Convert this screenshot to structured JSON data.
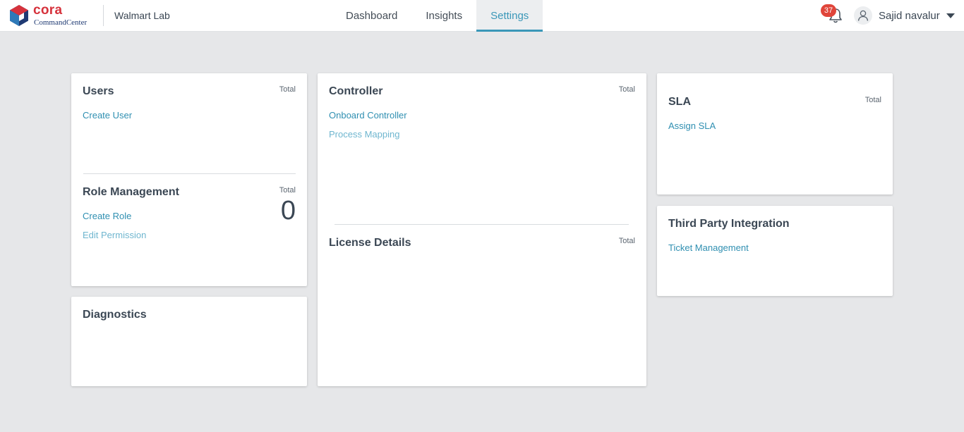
{
  "header": {
    "logo": {
      "brand": "cora",
      "product": "CommandCenter"
    },
    "org_name": "Walmart Lab",
    "tabs": [
      {
        "label": "Dashboard",
        "active": false
      },
      {
        "label": "Insights",
        "active": false
      },
      {
        "label": "Settings",
        "active": true
      }
    ],
    "notifications": {
      "icon": "bell-icon",
      "count": "37"
    },
    "user": {
      "icon": "user-icon",
      "name": "Sajid navalur",
      "menu_icon": "caret-down-icon"
    }
  },
  "cards": {
    "users": {
      "title": "Users",
      "total_label": "Total",
      "links": [
        "Create User"
      ]
    },
    "role_management": {
      "title": "Role Management",
      "total_label": "Total",
      "total_value": "0",
      "links": [
        "Create Role",
        "Edit Permission"
      ]
    },
    "diagnostics": {
      "title": "Diagnostics"
    },
    "controller": {
      "title": "Controller",
      "total_label": "Total",
      "links": [
        "Onboard Controller",
        "Process Mapping"
      ]
    },
    "license_details": {
      "title": "License Details",
      "total_label": "Total"
    },
    "sla": {
      "title": "SLA",
      "total_label": "Total",
      "links": [
        "Assign SLA"
      ]
    },
    "third_party": {
      "title": "Third Party Integration",
      "links": [
        "Ticket Management"
      ]
    }
  },
  "colors": {
    "accent": "#3a97b8",
    "link": "#2f8fb1",
    "badge": "#e0453a",
    "brand_red": "#d6323c",
    "background": "#e6e7e9"
  }
}
